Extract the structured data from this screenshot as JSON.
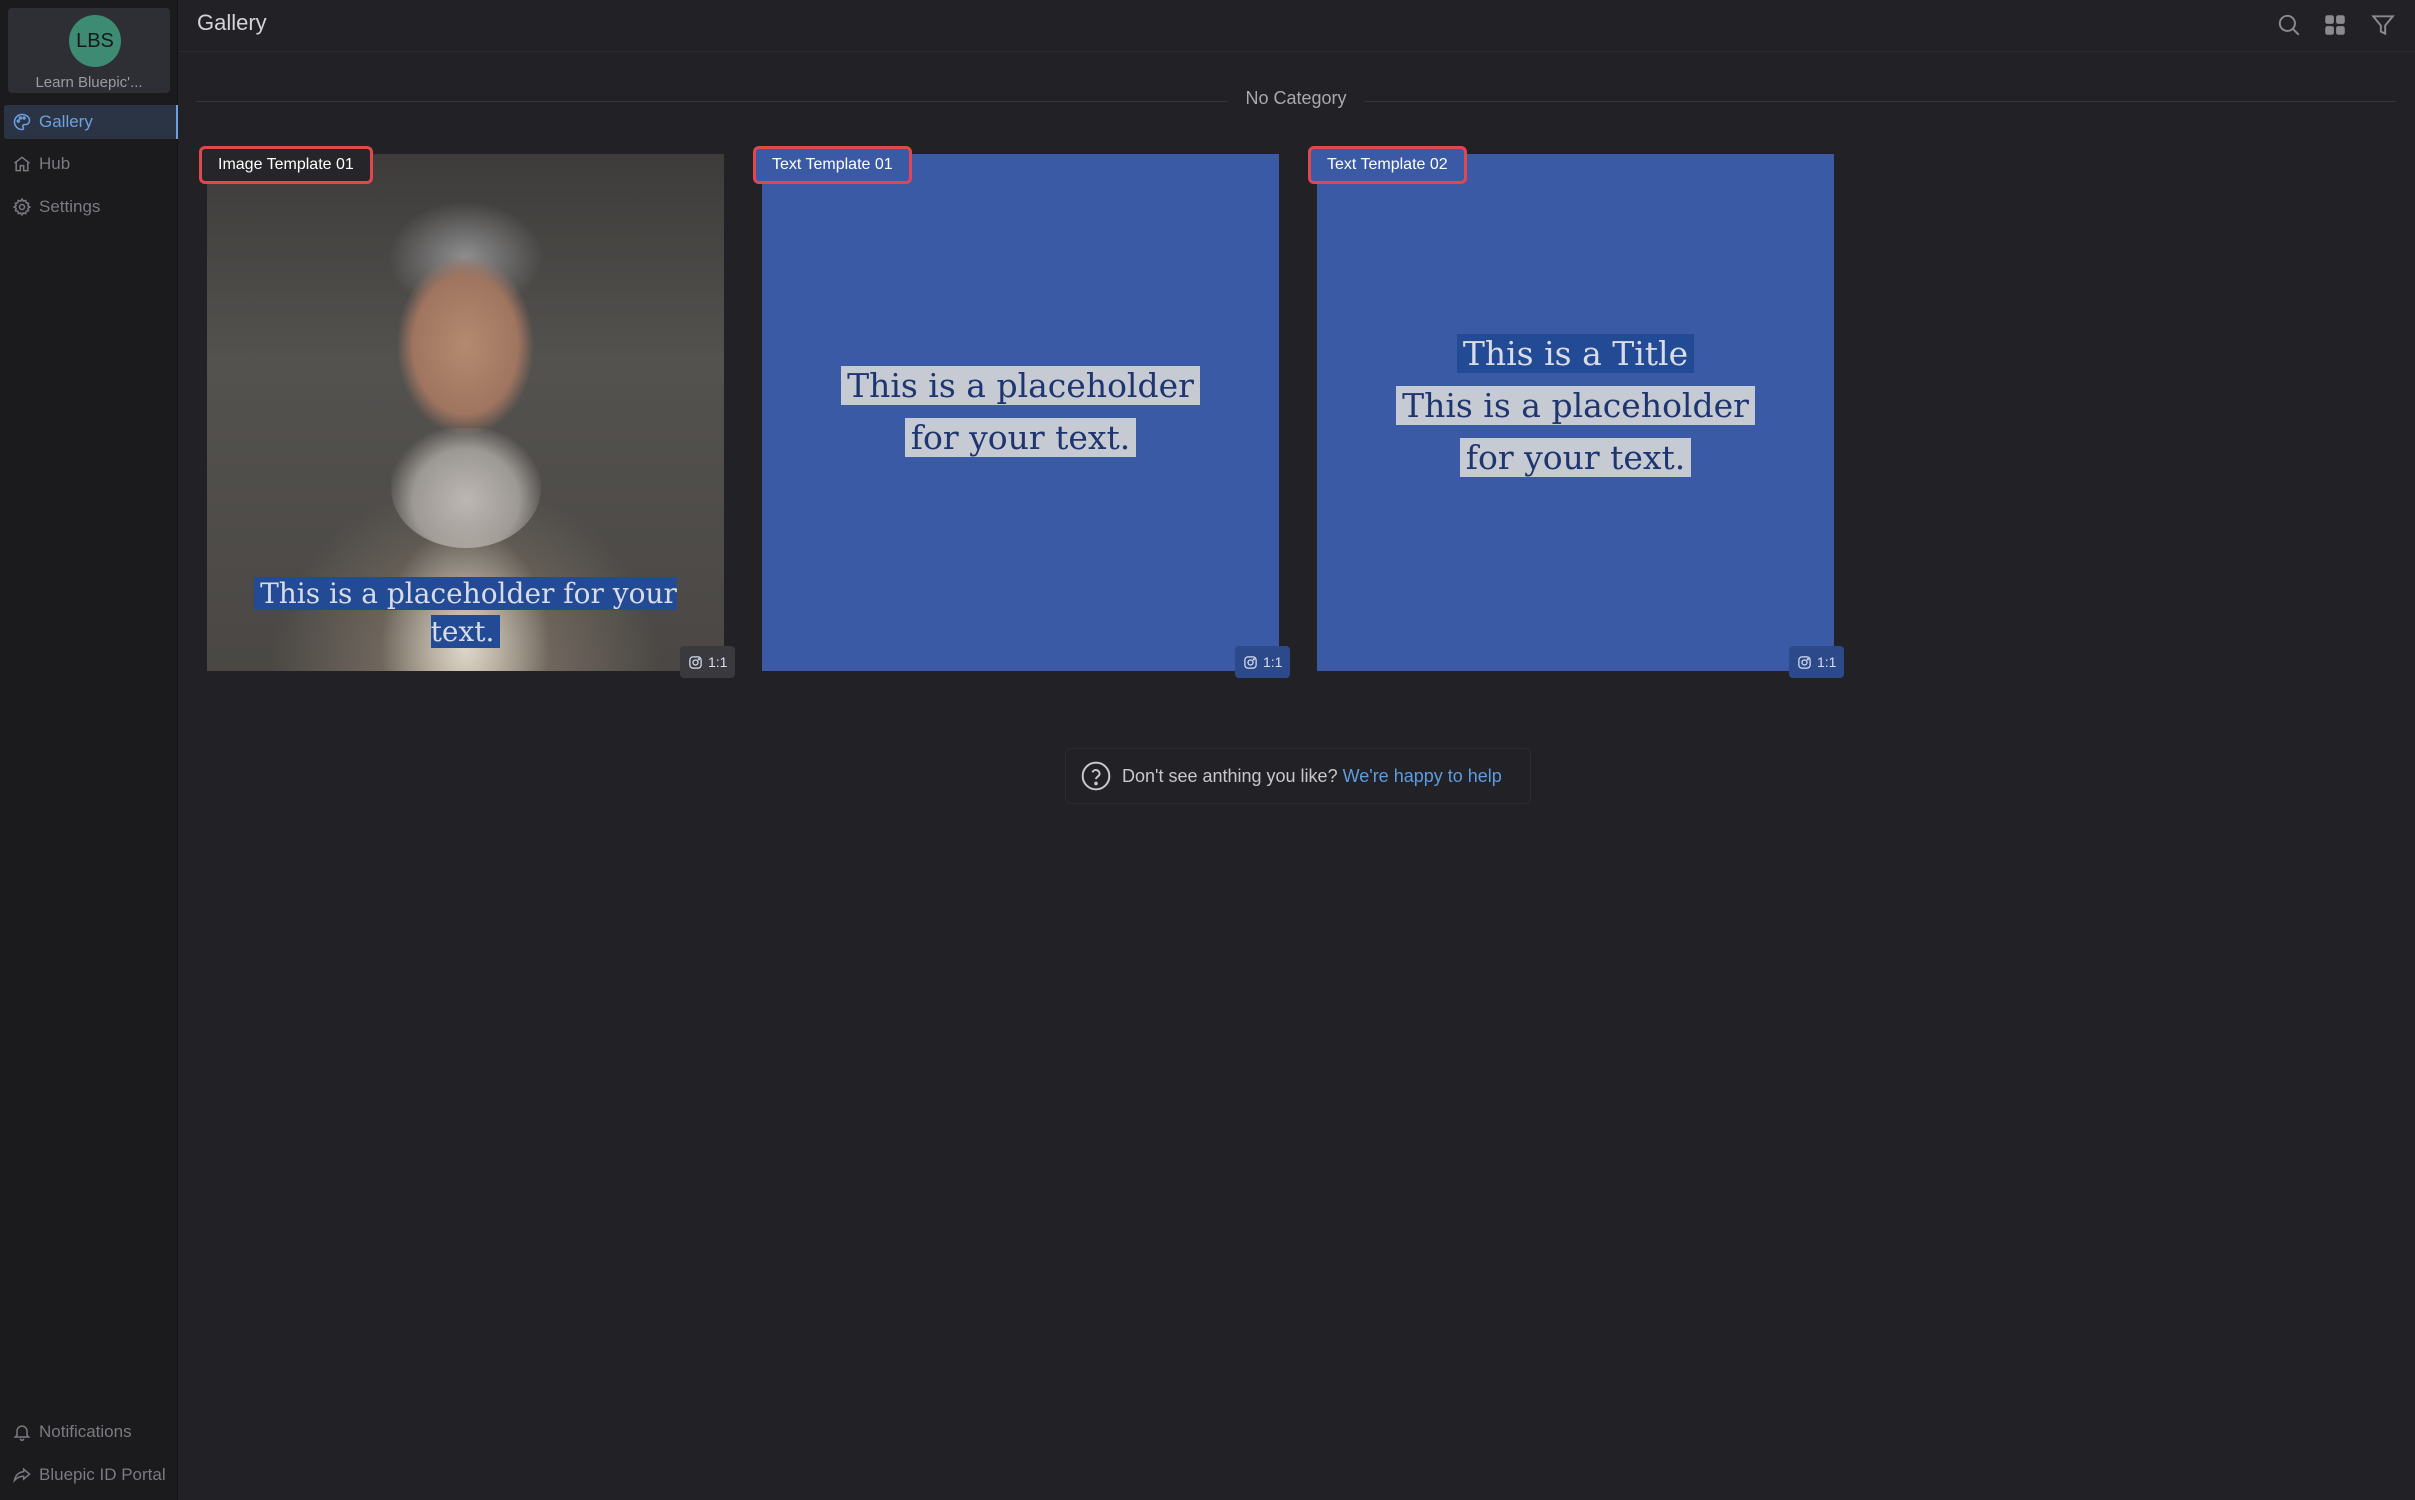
{
  "sidebar": {
    "workspace": {
      "initials": "LBS",
      "name": "Learn Bluepic'..."
    },
    "nav": [
      {
        "label": "Gallery",
        "icon": "palette-icon",
        "active": true
      },
      {
        "label": "Hub",
        "icon": "home-icon",
        "active": false
      },
      {
        "label": "Settings",
        "icon": "gear-icon",
        "active": false
      }
    ],
    "bottom": [
      {
        "label": "Notifications",
        "icon": "bell-icon"
      },
      {
        "label": "Bluepic ID Portal",
        "icon": "share-icon"
      }
    ]
  },
  "header": {
    "title": "Gallery",
    "icons": [
      "search-icon",
      "grid-icon",
      "filter-icon"
    ]
  },
  "category": {
    "label": "No Category"
  },
  "templates": [
    {
      "name": "Image Template 01",
      "caption": "This is a placeholder for your text.",
      "ratio": "1:1"
    },
    {
      "name": "Text Template 01",
      "line1": "This is a placeholder",
      "line2": "for your text.",
      "ratio": "1:1"
    },
    {
      "name": "Text Template 02",
      "title": "This is a Title",
      "line1": "This is a placeholder",
      "line2": "for your text.",
      "ratio": "1:1"
    }
  ],
  "help": {
    "text": "Don't see anthing you like?",
    "link": "We're happy to help"
  },
  "colors": {
    "background": "#222226",
    "sidebar": "#1b1b1e",
    "accent": "#6ea0e0",
    "card_blue": "#3a5aa5",
    "tag_border": "#e0484e"
  }
}
